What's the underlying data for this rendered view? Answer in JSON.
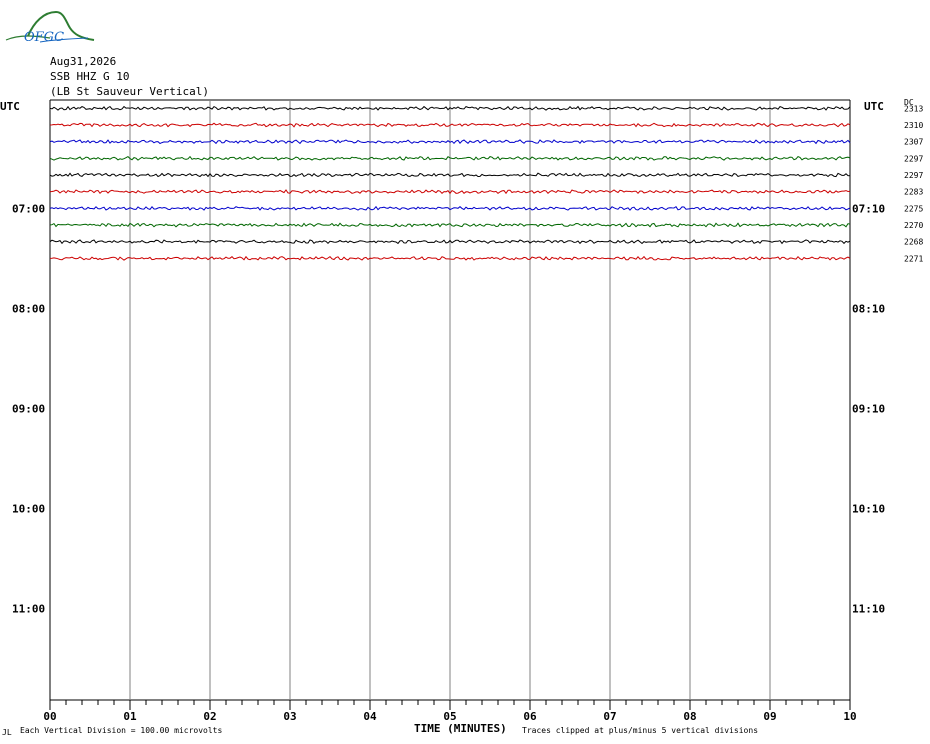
{
  "logo": {
    "text": "OFGC"
  },
  "header": {
    "date": "Aug31,2026",
    "station": "SSB HHZ G 10",
    "location": "(LB  St Sauveur Vertical)"
  },
  "axis_labels": {
    "utc_left": "UTC",
    "utc_right": "UTC",
    "dc": "DC",
    "x_title": "TIME (MINUTES)"
  },
  "footer": {
    "note_left": "Each Vertical Division =  100.00 microvolts",
    "note_right": "Traces clipped at plus/minus 5 vertical divisions",
    "corner_mark": "JL"
  },
  "colors": {
    "trace_cycle": [
      "#000000",
      "#cc0000",
      "#0000cc",
      "#006600"
    ],
    "grid": "#808080"
  },
  "chart_data": {
    "type": "line",
    "title": "SSB HHZ G 10",
    "xlabel": "TIME (MINUTES)",
    "x_ticks": [
      "00",
      "01",
      "02",
      "03",
      "04",
      "05",
      "06",
      "07",
      "08",
      "09",
      "10"
    ],
    "xlim": [
      0,
      10
    ],
    "left_hour_labels": [
      "07:00",
      "08:00",
      "09:00",
      "10:00",
      "11:00"
    ],
    "right_hour_labels": [
      "07:10",
      "08:10",
      "09:10",
      "10:10",
      "11:10"
    ],
    "dc_offsets": [
      "2313",
      "2310",
      "2307",
      "2297",
      "2297",
      "2283",
      "2275",
      "2270",
      "2268",
      "2271"
    ],
    "trace_colors": [
      "black",
      "red",
      "blue",
      "green",
      "black",
      "red",
      "blue",
      "green",
      "black",
      "red"
    ],
    "traces_drawn": 10,
    "grid": true
  }
}
